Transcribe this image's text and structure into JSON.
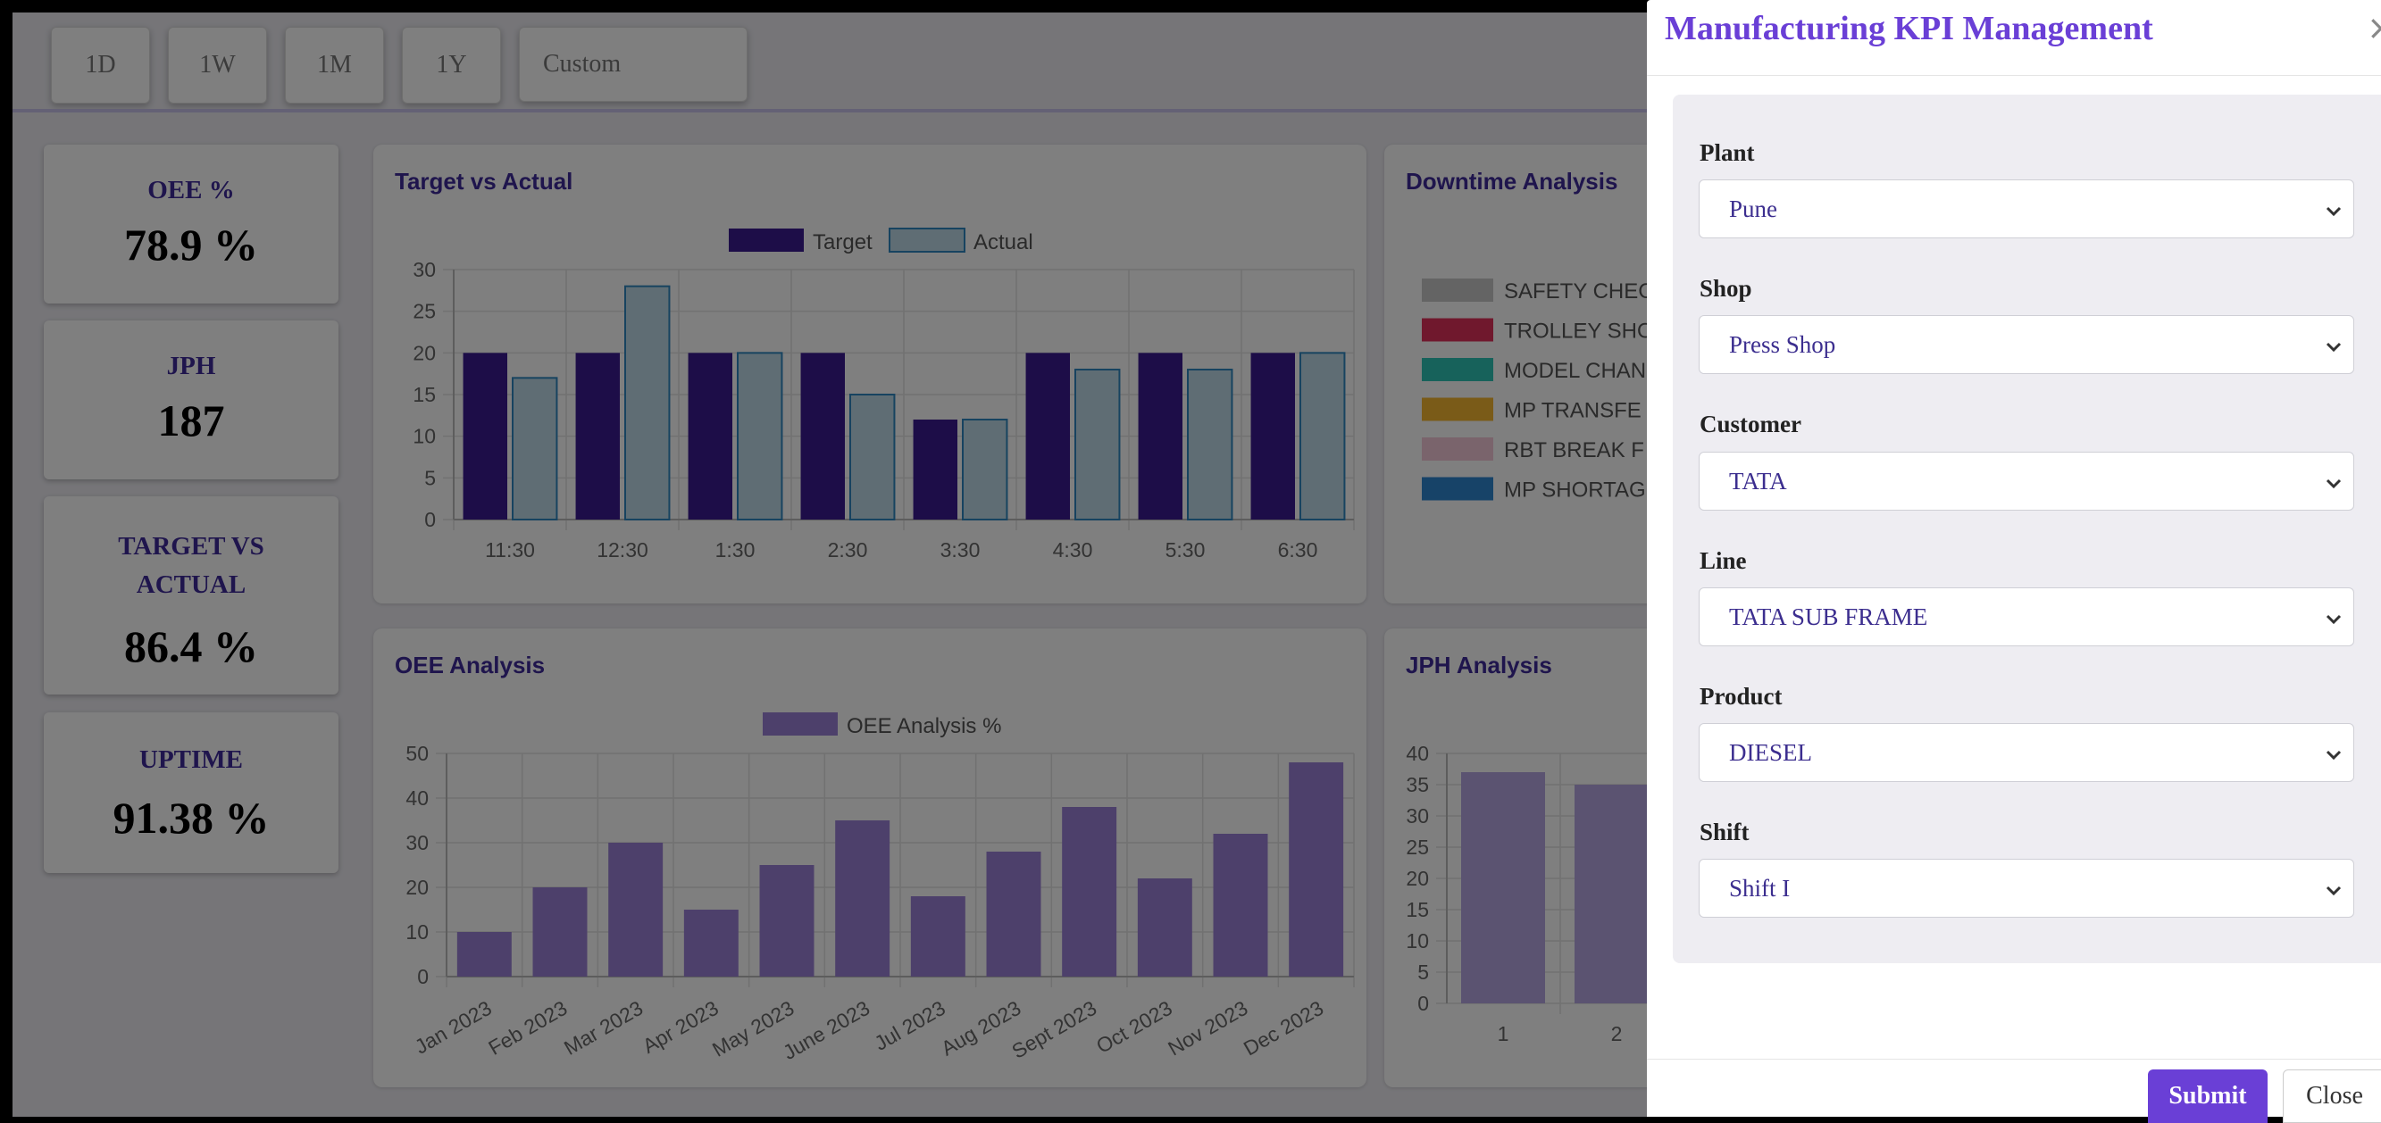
{
  "toolbar": {
    "ranges": [
      "1D",
      "1W",
      "1M",
      "1Y"
    ],
    "custom_label": "Custom"
  },
  "kpis": [
    {
      "title": "OEE %",
      "value": "78.9 %"
    },
    {
      "title": "JPH",
      "value": "187"
    },
    {
      "title": "TARGET VS ACTUAL",
      "value": "86.4 %"
    },
    {
      "title": "UPTIME",
      "value": "91.38 %"
    }
  ],
  "colors": {
    "accent": "#6a3fd6",
    "heading": "#3f2b9b",
    "target": "#3b1a91",
    "actual": "#bfdbe8",
    "actual_border": "#2f86c0",
    "oee_bar": "#9b80d6",
    "jph_bar": "#b6a7e2"
  },
  "panels": {
    "target_vs_actual": {
      "title": "Target vs Actual"
    },
    "downtime": {
      "title": "Downtime Analysis"
    },
    "oee": {
      "title": "OEE Analysis"
    },
    "jph": {
      "title": "JPH Analysis"
    }
  },
  "chart_data": [
    {
      "id": "target_vs_actual",
      "type": "bar",
      "title": "Target vs Actual",
      "categories": [
        "11:30",
        "12:30",
        "1:30",
        "2:30",
        "3:30",
        "4:30",
        "5:30",
        "6:30"
      ],
      "series": [
        {
          "name": "Target",
          "values": [
            20,
            20,
            20,
            20,
            12,
            20,
            20,
            20
          ],
          "color": "#3b1a91"
        },
        {
          "name": "Actual",
          "values": [
            17,
            28,
            20,
            15,
            12,
            18,
            18,
            20
          ],
          "color": "#bfdbe8"
        }
      ],
      "ylim": [
        0,
        30
      ],
      "yticks": [
        0,
        5,
        10,
        15,
        20,
        25,
        30
      ],
      "legend": "top-center",
      "grid": true
    },
    {
      "id": "downtime",
      "type": "pie",
      "title": "Downtime Analysis",
      "legend_entries": [
        {
          "label": "SAFETY CHEC",
          "color": "#c9c9c9"
        },
        {
          "label": "TROLLEY SHO",
          "color": "#e0305a"
        },
        {
          "label": "MODEL CHAN",
          "color": "#2ec4b6"
        },
        {
          "label": "MP TRANSFE",
          "color": "#f5b731"
        },
        {
          "label": "RBT BREAK F",
          "color": "#f4c8d8"
        },
        {
          "label": "MP SHORTAG",
          "color": "#2f86d0"
        }
      ]
    },
    {
      "id": "oee",
      "type": "bar",
      "title": "OEE Analysis",
      "categories": [
        "Jan 2023",
        "Feb 2023",
        "Mar 2023",
        "Apr 2023",
        "May 2023",
        "June 2023",
        "Jul 2023",
        "Aug 2023",
        "Sept 2023",
        "Oct 2023",
        "Nov 2023",
        "Dec 2023"
      ],
      "series": [
        {
          "name": "OEE Analysis %",
          "values": [
            10,
            20,
            30,
            15,
            25,
            35,
            18,
            28,
            38,
            22,
            32,
            48
          ],
          "color": "#9b80d6"
        }
      ],
      "ylim": [
        0,
        50
      ],
      "yticks": [
        0,
        10,
        20,
        30,
        40,
        50
      ],
      "legend": "top-center",
      "grid": true
    },
    {
      "id": "jph",
      "type": "bar",
      "title": "JPH Analysis",
      "categories": [
        "1",
        "2"
      ],
      "series": [
        {
          "values": [
            37,
            35
          ],
          "color": "#b6a7e2"
        }
      ],
      "ylim": [
        0,
        40
      ],
      "yticks": [
        0,
        5,
        10,
        15,
        20,
        25,
        30,
        35,
        40
      ],
      "grid": true
    }
  ],
  "modal": {
    "title": "Manufacturing KPI Management",
    "fields": [
      {
        "label": "Plant",
        "value": "Pune"
      },
      {
        "label": "Shop",
        "value": "Press Shop"
      },
      {
        "label": "Customer",
        "value": "TATA"
      },
      {
        "label": "Line",
        "value": "TATA SUB FRAME"
      },
      {
        "label": "Product",
        "value": "DIESEL"
      },
      {
        "label": "Shift",
        "value": "Shift I"
      }
    ],
    "submit_label": "Submit",
    "close_label": "Close"
  }
}
